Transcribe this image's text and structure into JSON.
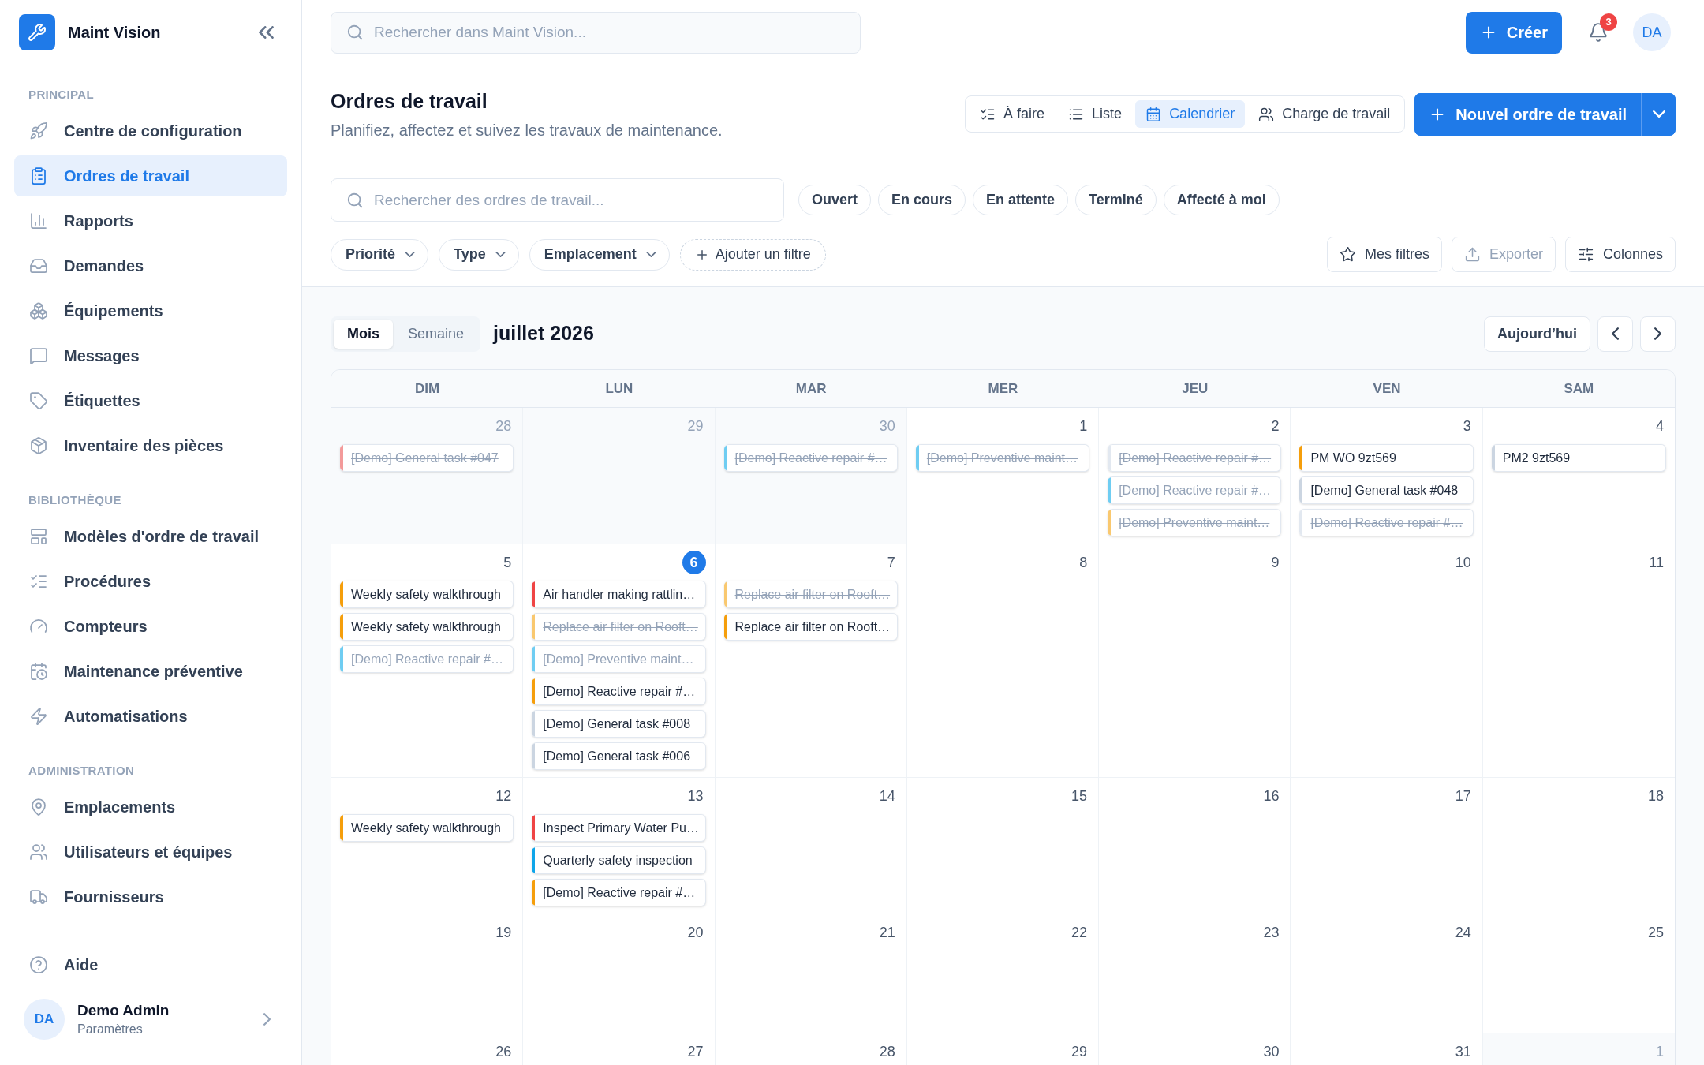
{
  "sidebar": {
    "app_name": "Maint Vision",
    "sections": [
      {
        "title": "PRINCIPAL",
        "items": [
          {
            "label": "Centre de configuration",
            "selected": false
          },
          {
            "label": "Ordres de travail",
            "selected": true
          },
          {
            "label": "Rapports",
            "selected": false
          },
          {
            "label": "Demandes",
            "selected": false
          },
          {
            "label": "Équipements",
            "selected": false
          },
          {
            "label": "Messages",
            "selected": false
          },
          {
            "label": "Étiquettes",
            "selected": false
          },
          {
            "label": "Inventaire des pièces",
            "selected": false
          }
        ]
      },
      {
        "title": "BIBLIOTHÈQUE",
        "items": [
          {
            "label": "Modèles d'ordre de travail",
            "selected": false
          },
          {
            "label": "Procédures",
            "selected": false
          },
          {
            "label": "Compteurs",
            "selected": false
          },
          {
            "label": "Maintenance préventive",
            "selected": false
          },
          {
            "label": "Automatisations",
            "selected": false
          }
        ]
      },
      {
        "title": "ADMINISTRATION",
        "items": [
          {
            "label": "Emplacements",
            "selected": false
          },
          {
            "label": "Utilisateurs et équipes",
            "selected": false
          },
          {
            "label": "Fournisseurs",
            "selected": false
          }
        ]
      }
    ],
    "help": "Aide",
    "user": {
      "initials": "DA",
      "name": "Demo Admin",
      "subtitle": "Paramètres"
    }
  },
  "topbar": {
    "search": {
      "placeholder": "Rechercher dans Maint Vision..."
    },
    "create_button": "Créer",
    "notification_count": "3",
    "avatar_initials": "DA"
  },
  "page_header": {
    "title": "Ordres de travail",
    "subtitle": "Planifiez, affectez et suivez les travaux de maintenance.",
    "view_tabs": [
      {
        "label": "À faire",
        "selected": false
      },
      {
        "label": "Liste",
        "selected": false
      },
      {
        "label": "Calendrier",
        "selected": true
      },
      {
        "label": "Charge de travail",
        "selected": false
      }
    ],
    "primary_button": "Nouvel ordre de travail"
  },
  "filters": {
    "search": {
      "placeholder": "Rechercher des ordres de travail..."
    },
    "status_chips": [
      {
        "label": "Ouvert",
        "selected": false
      },
      {
        "label": "En cours",
        "selected": false
      },
      {
        "label": "En attente",
        "selected": false
      },
      {
        "label": "Terminé",
        "selected": false
      },
      {
        "label": "Affecté à moi",
        "selected": false
      }
    ],
    "dropdowns": [
      "Priorité",
      "Type",
      "Emplacement"
    ],
    "add_filter": "Ajouter un filtre",
    "actions": [
      {
        "label": "Mes filtres",
        "disabled": false
      },
      {
        "label": "Exporter",
        "disabled": true
      },
      {
        "label": "Colonnes",
        "disabled": false
      }
    ]
  },
  "calendar": {
    "modes": [
      {
        "label": "Mois",
        "selected": true
      },
      {
        "label": "Semaine",
        "selected": false
      }
    ],
    "month_title": "juillet 2026",
    "today_button": "Aujourd’hui",
    "weekdays": [
      "DIM",
      "LUN",
      "MAR",
      "MER",
      "JEU",
      "VEN",
      "SAM"
    ],
    "weeks": [
      {
        "days": [
          {
            "number": "28",
            "outside": true,
            "today": false,
            "events": [
              {
                "title": "[Demo] General task #047",
                "color": "#f39a9a",
                "done": true
              }
            ]
          },
          {
            "number": "29",
            "outside": true,
            "today": false
          },
          {
            "number": "30",
            "outside": true,
            "today": false,
            "events": [
              {
                "title": "[Demo] Reactive repair #…",
                "color": "#6fcdf2",
                "done": true
              }
            ]
          },
          {
            "number": "1",
            "outside": false,
            "today": false,
            "events": [
              {
                "title": "[Demo] Preventive maint…",
                "color": "#6fcdf2",
                "done": true
              }
            ]
          },
          {
            "number": "2",
            "outside": false,
            "today": false,
            "events": [
              {
                "title": "[Demo] Reactive repair #…",
                "color": "#e2e8f0",
                "done": true
              },
              {
                "title": "[Demo] Reactive repair #…",
                "color": "#6fcdf2",
                "done": true
              },
              {
                "title": "[Demo] Preventive maint…",
                "color": "#f9c86f",
                "done": true
              }
            ]
          },
          {
            "number": "3",
            "outside": false,
            "today": false,
            "events": [
              {
                "title": "PM WO 9zt569",
                "color": "#f59e0b",
                "done": false
              },
              {
                "title": "[Demo] General task #048",
                "color": "#cbd5e1",
                "done": false
              },
              {
                "title": "[Demo] Reactive repair #…",
                "color": "#e2e8f0",
                "done": true
              }
            ]
          },
          {
            "number": "4",
            "outside": false,
            "today": false,
            "events": [
              {
                "title": "PM2 9zt569",
                "color": "#cbd5e1",
                "done": false
              }
            ]
          }
        ]
      },
      {
        "days": [
          {
            "number": "5",
            "outside": false,
            "today": false,
            "events": [
              {
                "title": "Weekly safety walkthrough",
                "color": "#f59e0b",
                "done": false
              },
              {
                "title": "Weekly safety walkthrough",
                "color": "#f59e0b",
                "done": false
              },
              {
                "title": "[Demo] Reactive repair #…",
                "color": "#6fcdf2",
                "done": true
              }
            ]
          },
          {
            "number": "6",
            "outside": false,
            "today": true,
            "events": [
              {
                "title": "Air handler making rattlin…",
                "color": "#ef4444",
                "done": false
              },
              {
                "title": "Replace air filter on Rooft…",
                "color": "#f9c86f",
                "done": true
              },
              {
                "title": "[Demo] Preventive maint…",
                "color": "#6fcdf2",
                "done": true
              },
              {
                "title": "[Demo] Reactive repair #…",
                "color": "#f59e0b",
                "done": false
              },
              {
                "title": "[Demo] General task #008",
                "color": "#cbd5e1",
                "done": false
              },
              {
                "title": "[Demo] General task #006",
                "color": "#cbd5e1",
                "done": false
              }
            ]
          },
          {
            "number": "7",
            "outside": false,
            "today": false,
            "events": [
              {
                "title": "Replace air filter on Rooft…",
                "color": "#f9c86f",
                "done": true
              },
              {
                "title": "Replace air filter on Rooft…",
                "color": "#f59e0b",
                "done": false
              }
            ]
          },
          {
            "number": "8",
            "outside": false,
            "today": false
          },
          {
            "number": "9",
            "outside": false,
            "today": false
          },
          {
            "number": "10",
            "outside": false,
            "today": false
          },
          {
            "number": "11",
            "outside": false,
            "today": false
          }
        ]
      },
      {
        "days": [
          {
            "number": "12",
            "outside": false,
            "today": false,
            "events": [
              {
                "title": "Weekly safety walkthrough",
                "color": "#f59e0b",
                "done": false
              }
            ]
          },
          {
            "number": "13",
            "outside": false,
            "today": false,
            "events": [
              {
                "title": "Inspect Primary Water Pu…",
                "color": "#ef4444",
                "done": false
              },
              {
                "title": "Quarterly safety inspection",
                "color": "#0ea5e9",
                "done": false
              },
              {
                "title": "[Demo] Reactive repair #…",
                "color": "#f59e0b",
                "done": false
              }
            ]
          },
          {
            "number": "14",
            "outside": false,
            "today": false
          },
          {
            "number": "15",
            "outside": false,
            "today": false
          },
          {
            "number": "16",
            "outside": false,
            "today": false
          },
          {
            "number": "17",
            "outside": false,
            "today": false
          },
          {
            "number": "18",
            "outside": false,
            "today": false
          }
        ]
      },
      {
        "days": [
          {
            "number": "19",
            "outside": false,
            "today": false
          },
          {
            "number": "20",
            "outside": false,
            "today": false
          },
          {
            "number": "21",
            "outside": false,
            "today": false
          },
          {
            "number": "22",
            "outside": false,
            "today": false
          },
          {
            "number": "23",
            "outside": false,
            "today": false
          },
          {
            "number": "24",
            "outside": false,
            "today": false
          },
          {
            "number": "25",
            "outside": false,
            "today": false
          }
        ]
      },
      {
        "days": [
          {
            "number": "26",
            "outside": false,
            "today": false
          },
          {
            "number": "27",
            "outside": false,
            "today": false
          },
          {
            "number": "28",
            "outside": false,
            "today": false
          },
          {
            "number": "29",
            "outside": false,
            "today": false
          },
          {
            "number": "30",
            "outside": false,
            "today": false
          },
          {
            "number": "31",
            "outside": false,
            "today": false
          },
          {
            "number": "1",
            "outside": true,
            "today": false
          }
        ]
      }
    ]
  }
}
